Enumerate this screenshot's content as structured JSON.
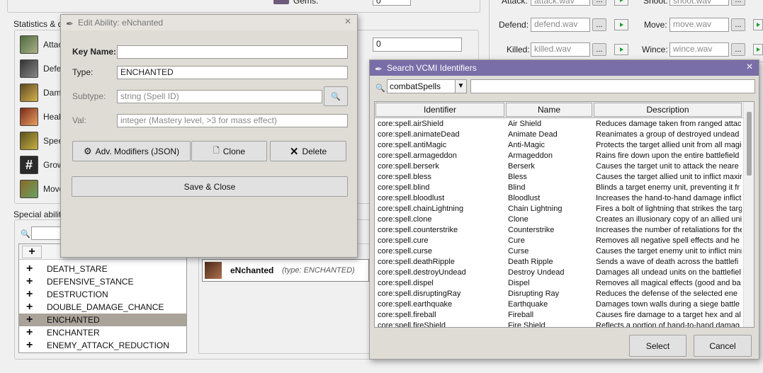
{
  "background": {
    "gems_label": "Gems:",
    "gems_value": "0",
    "stats_group_title": "Statistics & da",
    "stats_rows": [
      {
        "label": "Attac"
      },
      {
        "label": "Defe"
      },
      {
        "label": "Dama"
      },
      {
        "label": "Healt"
      },
      {
        "label": "Spee"
      },
      {
        "label": "Grow"
      },
      {
        "label": "Move"
      }
    ],
    "stat_value": "0",
    "special_abilities_title": "Special abiliti",
    "list_items": [
      "DEATH_STARE",
      "DEFENSIVE_STANCE",
      "DESTRUCTION",
      "DOUBLE_DAMAGE_CHANCE",
      "ENCHANTED",
      "ENCHANTER",
      "ENEMY_ATTACK_REDUCTION"
    ],
    "selected_item": "ENCHANTED",
    "ability_card": {
      "name": "eNchanted",
      "type_text": "(type: ENCHANTED)"
    },
    "sounds": {
      "attack_label": "Attack:",
      "attack_value": "attack.wav",
      "shoot_label": "Shoot:",
      "shoot_value": "shoot.wav",
      "defend_label": "Defend:",
      "defend_value": "defend.wav",
      "move_label": "Move:",
      "move_value": "move.wav",
      "killed_label": "Killed:",
      "killed_value": "killed.wav",
      "wince_label": "Wince:",
      "wince_value": "wince.wav",
      "browse_label": "..."
    }
  },
  "edit_dialog": {
    "title": "Edit Ability: eNchanted",
    "key_name_label": "Key Name:",
    "key_name_value": "",
    "type_label": "Type:",
    "type_value": "ENCHANTED",
    "subtype_label": "Subtype:",
    "subtype_placeholder": "string (Spell ID)",
    "val_label": "Val:",
    "val_placeholder": "integer (Mastery level, >3 for mass effect)",
    "adv_modifiers_label": "Adv. Modifiers (JSON)",
    "clone_label": "Clone",
    "delete_label": "Delete",
    "save_close_label": "Save & Close"
  },
  "search_dialog": {
    "title": "Search VCMI Identifiers",
    "category_value": "combatSpells",
    "search_value": "",
    "columns": [
      "Identifier",
      "Name",
      "Description"
    ],
    "rows": [
      [
        "core:spell.airShield",
        "Air Shield",
        "Reduces damage taken from ranged attac"
      ],
      [
        "core:spell.animateDead",
        "Animate Dead",
        "Reanimates a group of destroyed undead"
      ],
      [
        "core:spell.antiMagic",
        "Anti-Magic",
        "Protects the target allied unit from all magic"
      ],
      [
        "core:spell.armageddon",
        "Armageddon",
        "Rains fire down upon the entire battlefield"
      ],
      [
        "core:spell.berserk",
        "Berserk",
        "Causes the target unit to attack the neare"
      ],
      [
        "core:spell.bless",
        "Bless",
        "Causes the target allied unit to inflict maxin"
      ],
      [
        "core:spell.blind",
        "Blind",
        "Blinds a target enemy unit, preventing it fr"
      ],
      [
        "core:spell.bloodlust",
        "Bloodlust",
        "Increases the hand-to-hand damage inflict"
      ],
      [
        "core:spell.chainLightning",
        "Chain Lightning",
        "Fires a bolt of lightning that strikes the targ"
      ],
      [
        "core:spell.clone",
        "Clone",
        "Creates an illusionary copy of an allied uni"
      ],
      [
        "core:spell.counterstrike",
        "Counterstrike",
        "Increases the number of retaliations for the"
      ],
      [
        "core:spell.cure",
        "Cure",
        "Removes all negative spell effects and he"
      ],
      [
        "core:spell.curse",
        "Curse",
        "Causes the target enemy unit to inflict mini"
      ],
      [
        "core:spell.deathRipple",
        "Death Ripple",
        "Sends a wave of death across the battlefi"
      ],
      [
        "core:spell.destroyUndead",
        "Destroy Undead",
        "Damages all undead units on the battlefiel"
      ],
      [
        "core:spell.dispel",
        "Dispel",
        "Removes all magical effects (good and ba"
      ],
      [
        "core:spell.disruptingRay",
        "Disrupting Ray",
        "Reduces the defense of the selected ene"
      ],
      [
        "core:spell.earthquake",
        "Earthquake",
        "Damages town walls during a siege battle"
      ],
      [
        "core:spell.fireball",
        "Fireball",
        "Causes fire damage to a target hex and al"
      ],
      [
        "core:spell.fireShield",
        "Fire Shield",
        "Reflects a portion of hand-to-hand damag"
      ]
    ],
    "select_label": "Select",
    "cancel_label": "Cancel"
  },
  "colors": {
    "search_title_bar": "#7a6ea8",
    "list_selected": "#aaa39a"
  }
}
